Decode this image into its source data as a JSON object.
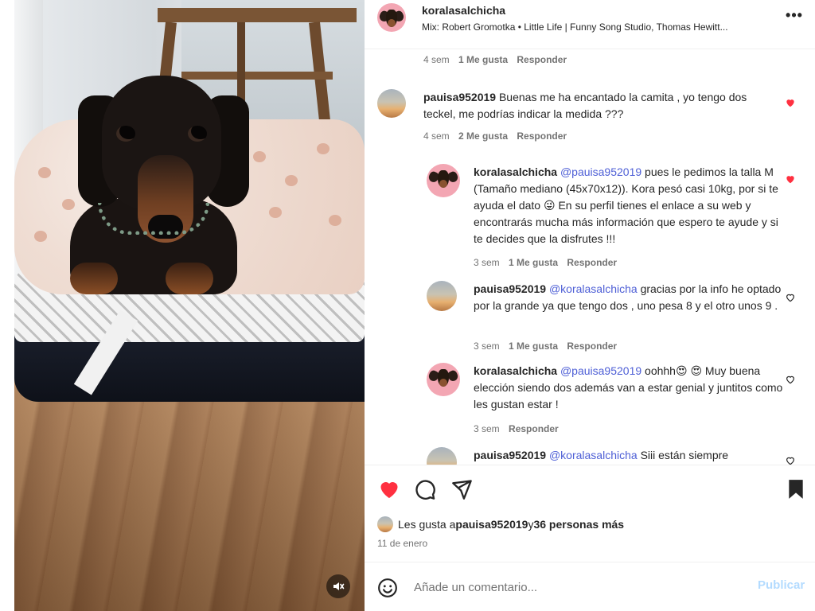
{
  "header": {
    "username": "koralasalchicha",
    "audio": "Mix: Robert Gromotka • Little Life | Funny Song Studio, Thomas Hewitt...",
    "options_icon": "more-horizontal-icon",
    "options_label": "•••"
  },
  "comments": [
    {
      "time": "4 sem",
      "likes": "1 Me gusta",
      "reply": "Responder"
    },
    {
      "username": "pauisa952019",
      "text": " Buenas me ha encantado la camita , yo tengo dos teckel, me podrías indicar la medida ???",
      "time": "4 sem",
      "likes": "2 Me gusta",
      "reply": "Responder",
      "liked": true
    },
    {
      "username": "koralasalchicha",
      "mention": "@pauisa952019",
      "text": " pues le pedimos la talla M (Tamaño mediano (45x70x12)). Kora pesó casi 10kg, por si te ayuda el dato 😜 En su perfil tienes el enlace a su web y encontrarás mucha más información que espero te ayude y si te decides que la disfrutes !!!",
      "time": "3 sem",
      "likes": "1 Me gusta",
      "reply": "Responder",
      "liked": true
    },
    {
      "username": "pauisa952019",
      "mention": "@koralasalchicha",
      "text": " gracias por la info he optado por la grande ya que tengo dos , uno pesa 8 y el otro unos 9 .",
      "time": "3 sem",
      "likes": "1 Me gusta",
      "reply": "Responder",
      "liked": false
    },
    {
      "username": "koralasalchicha",
      "mention": "@pauisa952019",
      "text": " oohhh😍 😍  Muy buena elección siendo dos además van a estar genial y juntitos como les gustan estar !",
      "time": "3 sem",
      "reply": "Responder",
      "liked": false
    },
    {
      "username": "pauisa952019",
      "mention": "@koralasalchicha",
      "text": " Siii están siempre",
      "liked": false
    }
  ],
  "actions": {
    "like_icon": "heart-filled-icon",
    "comment_icon": "comment-bubble-icon",
    "share_icon": "paper-plane-icon",
    "save_icon": "bookmark-filled-icon",
    "like_color": "#ff3040"
  },
  "likes": {
    "prefix": "Les gusta a ",
    "user": "pauisa952019",
    "middle": " y ",
    "others": "36 personas más"
  },
  "date": "11 de enero",
  "composer": {
    "placeholder": "Añade un comentario...",
    "publish_label": "Publicar",
    "emoji_icon": "smiley-icon"
  },
  "media": {
    "mute_icon": "muted-speaker-icon"
  }
}
